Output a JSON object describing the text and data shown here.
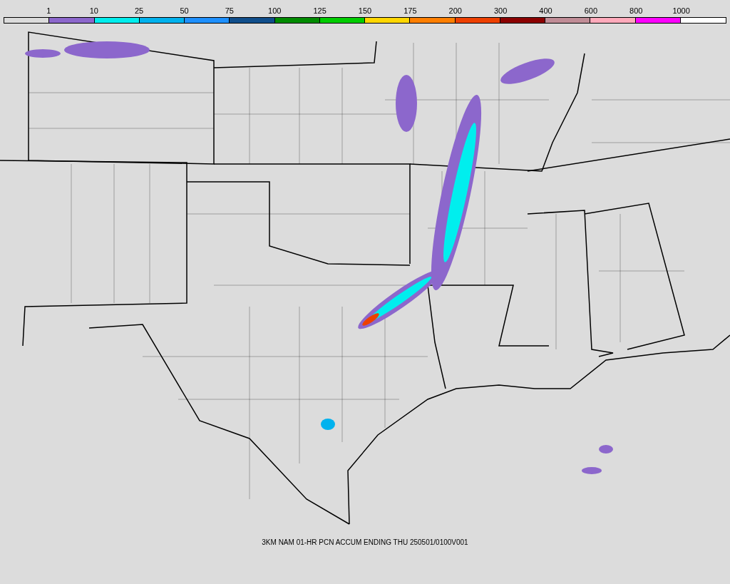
{
  "legend": {
    "labels": [
      "1",
      "10",
      "25",
      "50",
      "75",
      "100",
      "125",
      "150",
      "175",
      "200",
      "300",
      "400",
      "600",
      "800",
      "1000"
    ],
    "segments": [
      {
        "color": "#dcdcdc"
      },
      {
        "color": "#8c67cc"
      },
      {
        "color": "#00eeee"
      },
      {
        "color": "#00b2ee"
      },
      {
        "color": "#1e90ff"
      },
      {
        "color": "#104e8b"
      },
      {
        "color": "#008b00"
      },
      {
        "color": "#00cd00"
      },
      {
        "color": "#ffd700"
      },
      {
        "color": "#ff7f00"
      },
      {
        "color": "#ee4000"
      },
      {
        "color": "#8b0000"
      },
      {
        "color": "#c08c96"
      },
      {
        "color": "#ffaabb"
      },
      {
        "color": "#ff00ff"
      },
      {
        "color": "#ffffff"
      }
    ]
  },
  "caption": "3KM NAM 01-HR PCN ACCUM ENDING THU 250501/0100V001"
}
